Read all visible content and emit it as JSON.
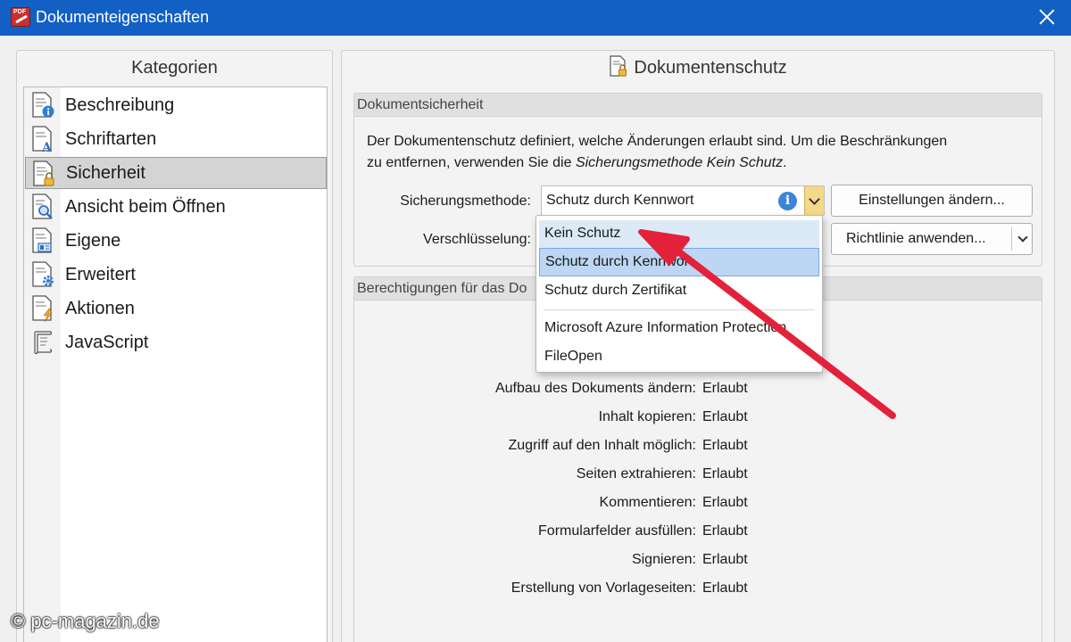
{
  "window": {
    "title": "Dokumenteigenschaften",
    "app_icon_text": "PDF"
  },
  "sidebar": {
    "header": "Kategorien",
    "items": [
      {
        "label": "Beschreibung",
        "icon": "document-info-icon",
        "selected": false
      },
      {
        "label": "Schriftarten",
        "icon": "document-font-icon",
        "selected": false
      },
      {
        "label": "Sicherheit",
        "icon": "document-lock-icon",
        "selected": true
      },
      {
        "label": "Ansicht beim Öffnen",
        "icon": "document-magnifier-icon",
        "selected": false
      },
      {
        "label": "Eigene",
        "icon": "document-custom-icon",
        "selected": false
      },
      {
        "label": "Erweitert",
        "icon": "document-gear-icon",
        "selected": false
      },
      {
        "label": "Aktionen",
        "icon": "document-lightning-icon",
        "selected": false
      },
      {
        "label": "JavaScript",
        "icon": "script-scroll-icon",
        "selected": false
      }
    ]
  },
  "main": {
    "header": "Dokumentenschutz",
    "security_group": {
      "title": "Dokumentsicherheit",
      "description_1": "Der Dokumentenschutz definiert, welche Änderungen erlaubt sind. Um die Beschränkungen",
      "description_2a": "zu entfernen, verwenden Sie die ",
      "description_2b": "Sicherungsmethode Kein Schutz",
      "description_2c": ".",
      "method_label": "Sicherungsmethode:",
      "method_value": "Schutz durch Kennwort",
      "encryption_label": "Verschlüsselung:",
      "settings_button": "Einstellungen ändern...",
      "policy_button": "Richtlinie anwenden..."
    },
    "permissions_group": {
      "title": "Berechtigungen für das Do",
      "rows": [
        {
          "label": "Aufbau des Dokuments ändern:",
          "value": "Erlaubt"
        },
        {
          "label": "Inhalt kopieren:",
          "value": "Erlaubt"
        },
        {
          "label": "Zugriff auf den Inhalt möglich:",
          "value": "Erlaubt"
        },
        {
          "label": "Seiten extrahieren:",
          "value": "Erlaubt"
        },
        {
          "label": "Kommentieren:",
          "value": "Erlaubt"
        },
        {
          "label": "Formularfelder ausfüllen:",
          "value": "Erlaubt"
        },
        {
          "label": "Signieren:",
          "value": "Erlaubt"
        },
        {
          "label": "Erstellung von Vorlageseiten:",
          "value": "Erlaubt"
        }
      ]
    }
  },
  "dropdown": {
    "options": [
      {
        "label": "Kein Schutz",
        "state": "hover"
      },
      {
        "label": "Schutz durch Kennwort",
        "state": "current"
      },
      {
        "label": "Schutz durch Zertifikat",
        "state": ""
      },
      {
        "label": "Microsoft Azure Information Protection",
        "state": ""
      },
      {
        "label": "FileOpen",
        "state": ""
      }
    ]
  },
  "annotation": {
    "arrow_color": "#e3213b"
  },
  "watermark": "© pc-magazin.de"
}
